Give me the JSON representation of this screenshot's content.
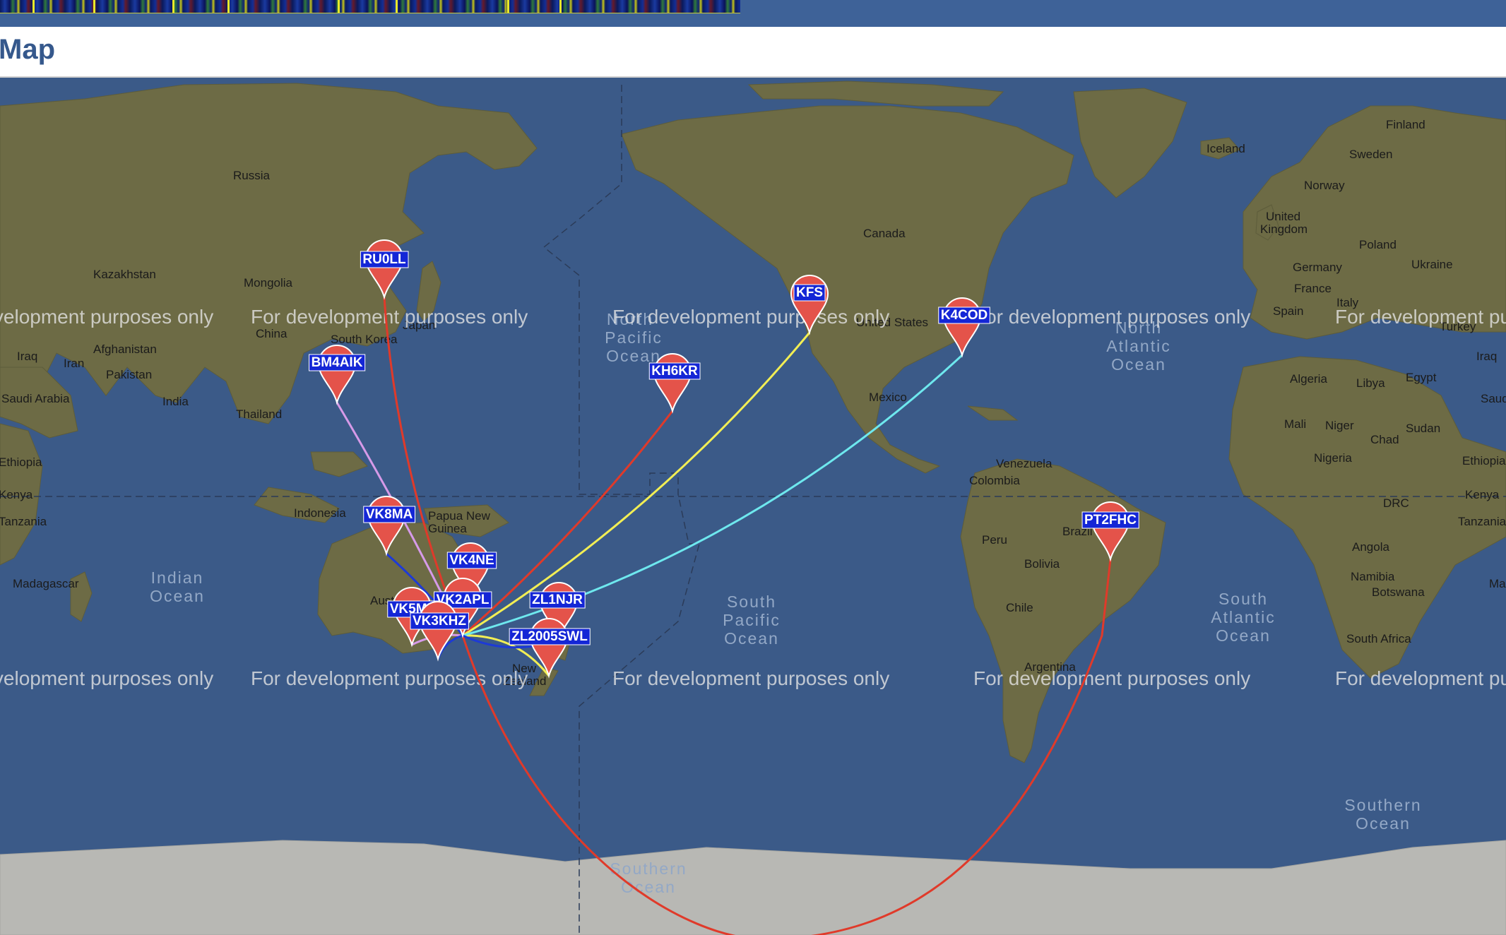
{
  "header": {
    "title": "Map"
  },
  "map": {
    "watermark": "For development purposes only",
    "countries": [
      "Russia",
      "Kazakhstan",
      "Mongolia",
      "China",
      "Japan",
      "South Korea",
      "Afghanistan",
      "Iran",
      "Iraq",
      "Pakistan",
      "India",
      "Saudi Arabia",
      "Thailand",
      "Ethiopia",
      "Kenya",
      "Tanzania",
      "Madagascar",
      "Indonesia",
      "Papua New Guinea",
      "Canada",
      "United States",
      "Mexico",
      "Venezuela",
      "Colombia",
      "Peru",
      "Bolivia",
      "Brazil",
      "Chile",
      "Argentina",
      "Iceland",
      "Finland",
      "Sweden",
      "Norway",
      "United Kingdom",
      "Poland",
      "Germany",
      "Ukraine",
      "France",
      "Spain",
      "Italy",
      "Turkey",
      "Algeria",
      "Libya",
      "Egypt",
      "Mali",
      "Niger",
      "Chad",
      "Sudan",
      "Nigeria",
      "DRC",
      "Angola",
      "Namibia",
      "Botswana",
      "South Africa",
      "Australia",
      "New Zealand"
    ],
    "oceans": [
      "North Pacific Ocean",
      "North Atlantic Ocean",
      "Indian Ocean",
      "South Pacific Ocean",
      "South Atlantic Ocean",
      "Southern Ocean"
    ],
    "colors": {
      "red": "#e03a2a",
      "yellow": "#f2ee54",
      "cyan": "#6ee8ee",
      "violet": "#d69ae8",
      "blue": "#1d3ad6",
      "marker": "#e4534a",
      "label_bg": "#1426d6"
    },
    "markers": [
      {
        "call": "RU0LL",
        "lat": 48.5,
        "lon": 135.1
      },
      {
        "call": "BM4AIK",
        "lat": 24.8,
        "lon": 121.0
      },
      {
        "call": "VK8MA",
        "lat": -12.5,
        "lon": 130.9
      },
      {
        "call": "KH6KR",
        "lat": 21.3,
        "lon": -157.9
      },
      {
        "call": "KFS",
        "lat": 37.6,
        "lon": -122.4
      },
      {
        "call": "K4COD",
        "lat": 35.8,
        "lon": -78.6
      },
      {
        "call": "PT2FHC",
        "lat": -15.8,
        "lon": -47.9
      },
      {
        "call": "VK4NE",
        "lat": -27.5,
        "lon": 153.0
      },
      {
        "call": "VK2APL",
        "lat": -33.9,
        "lon": 151.2
      },
      {
        "call": "VK5MR",
        "lat": -34.9,
        "lon": 138.6
      },
      {
        "call": "VK3KHZ",
        "lat": -37.8,
        "lon": 145.0
      },
      {
        "call": "ZL1NJR",
        "lat": -36.8,
        "lon": 174.8
      },
      {
        "call": "ZL2005SWL",
        "lat": -41.3,
        "lon": 174.8
      }
    ],
    "paths": [
      {
        "from": "VK2APL",
        "to": "RU0LL",
        "color": "red"
      },
      {
        "from": "VK2APL",
        "to": "KH6KR",
        "color": "red"
      },
      {
        "from": "VK2APL",
        "to": "PT2FHC",
        "color": "red"
      },
      {
        "from": "VK2APL",
        "to": "KFS",
        "color": "yellow"
      },
      {
        "from": "VK2APL",
        "to": "ZL2005SWL",
        "color": "yellow"
      },
      {
        "from": "VK2APL",
        "to": "K4COD",
        "color": "cyan"
      },
      {
        "from": "VK2APL",
        "to": "BM4AIK",
        "color": "violet"
      },
      {
        "from": "VK2APL",
        "to": "VK5MR",
        "color": "violet"
      },
      {
        "from": "VK2APL",
        "to": "VK8MA",
        "color": "blue"
      },
      {
        "from": "VK2APL",
        "to": "VK3KHZ",
        "color": "blue"
      },
      {
        "from": "VK2APL",
        "to": "ZL1NJR",
        "color": "blue"
      }
    ]
  }
}
